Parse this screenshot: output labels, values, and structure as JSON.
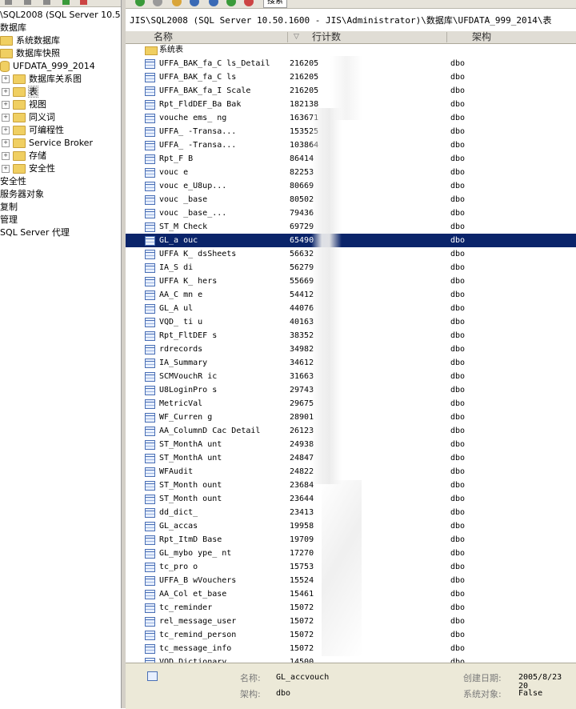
{
  "left_panel": {
    "tree": [
      {
        "label": "\\SQL2008 (SQL Server 10.50",
        "indent": 0,
        "icon": "none",
        "expander": ""
      },
      {
        "label": "数据库",
        "indent": 0,
        "icon": "none",
        "expander": ""
      },
      {
        "label": "系统数据库",
        "indent": 0,
        "icon": "folder",
        "expander": ""
      },
      {
        "label": "数据库快照",
        "indent": 0,
        "icon": "folder",
        "expander": ""
      },
      {
        "label": "UFDATA_999_2014",
        "indent": 0,
        "icon": "database",
        "expander": ""
      },
      {
        "label": "数据库关系图",
        "indent": 1,
        "icon": "folder",
        "expander": "+"
      },
      {
        "label": "表",
        "indent": 1,
        "icon": "folder",
        "expander": "+",
        "selected": true
      },
      {
        "label": "视图",
        "indent": 1,
        "icon": "folder",
        "expander": "+"
      },
      {
        "label": "同义词",
        "indent": 1,
        "icon": "folder",
        "expander": "+"
      },
      {
        "label": "可编程性",
        "indent": 1,
        "icon": "folder",
        "expander": "+"
      },
      {
        "label": "Service Broker",
        "indent": 1,
        "icon": "folder",
        "expander": "+"
      },
      {
        "label": "存储",
        "indent": 1,
        "icon": "folder",
        "expander": "+"
      },
      {
        "label": "安全性",
        "indent": 1,
        "icon": "folder",
        "expander": "+"
      },
      {
        "label": "安全性",
        "indent": 0,
        "icon": "none",
        "expander": ""
      },
      {
        "label": "服务器对象",
        "indent": 0,
        "icon": "none",
        "expander": ""
      },
      {
        "label": "复制",
        "indent": 0,
        "icon": "none",
        "expander": ""
      },
      {
        "label": "管理",
        "indent": 0,
        "icon": "none",
        "expander": ""
      },
      {
        "label": "SQL Server 代理",
        "indent": 0,
        "icon": "none",
        "expander": ""
      }
    ]
  },
  "right_panel": {
    "toolbar": {
      "search_tab": "搜索"
    },
    "path": "JIS\\SQL2008 (SQL Server 10.50.1600 - JIS\\Administrator)\\数据库\\UFDATA_999_2014\\表",
    "columns": {
      "name": "名称",
      "count": "行计数",
      "schema": "架构",
      "sort_indicator": "▽"
    },
    "rows": [
      {
        "name": "系统表",
        "count": "",
        "schema": "",
        "type": "folder"
      },
      {
        "name": "UFFA_BAK_fa_C    ls_Detail",
        "count": "216205",
        "schema": "dbo",
        "type": "table"
      },
      {
        "name": "UFFA_BAK_fa_C    ls",
        "count": "216205",
        "schema": "dbo",
        "type": "table"
      },
      {
        "name": "UFFA_BAK_fa_I    Scale",
        "count": "216205",
        "schema": "dbo",
        "type": "table"
      },
      {
        "name": "Rpt_FldDEF_Ba    Bak",
        "count": "182138",
        "schema": "dbo",
        "type": "table"
      },
      {
        "name": "vouche    ems_ ng",
        "count": "163671",
        "schema": "dbo",
        "type": "table"
      },
      {
        "name": "UFFA_     -Transa...",
        "count": "153525",
        "schema": "dbo",
        "type": "table"
      },
      {
        "name": "UFFA_     -Transa...",
        "count": "103864",
        "schema": "dbo",
        "type": "table"
      },
      {
        "name": "Rpt_F     B",
        "count": "86414",
        "schema": "dbo",
        "type": "table"
      },
      {
        "name": "vouc      e",
        "count": "82253",
        "schema": "dbo",
        "type": "table"
      },
      {
        "name": "vouc      e_U8up...",
        "count": "80669",
        "schema": "dbo",
        "type": "table"
      },
      {
        "name": "vouc      _base",
        "count": "80502",
        "schema": "dbo",
        "type": "table"
      },
      {
        "name": "vouc      _base_...",
        "count": "79436",
        "schema": "dbo",
        "type": "table"
      },
      {
        "name": "ST_M      Check",
        "count": "69729",
        "schema": "dbo",
        "type": "table"
      },
      {
        "name": "GL_a    ouc",
        "count": "65490",
        "schema": "dbo",
        "type": "table",
        "selected": true
      },
      {
        "name": "UFFA    K_   dsSheets",
        "count": "56632",
        "schema": "dbo",
        "type": "table"
      },
      {
        "name": "IA_S    di",
        "count": "56279",
        "schema": "dbo",
        "type": "table"
      },
      {
        "name": "UFFA    K_     hers",
        "count": "55669",
        "schema": "dbo",
        "type": "table"
      },
      {
        "name": "AA_C    mn    e",
        "count": "54412",
        "schema": "dbo",
        "type": "table"
      },
      {
        "name": "GL_A    ul",
        "count": "44076",
        "schema": "dbo",
        "type": "table"
      },
      {
        "name": "VQD_    ti   u",
        "count": "40163",
        "schema": "dbo",
        "type": "table"
      },
      {
        "name": "Rpt_FltDEF   s",
        "count": "38352",
        "schema": "dbo",
        "type": "table"
      },
      {
        "name": "rdrecords",
        "count": "34982",
        "schema": "dbo",
        "type": "table"
      },
      {
        "name": "IA_Summary",
        "count": "34612",
        "schema": "dbo",
        "type": "table"
      },
      {
        "name": "SCMVouchR    ic",
        "count": "31663",
        "schema": "dbo",
        "type": "table"
      },
      {
        "name": "U8LoginPro    s",
        "count": "29743",
        "schema": "dbo",
        "type": "table"
      },
      {
        "name": "MetricVal",
        "count": "29675",
        "schema": "dbo",
        "type": "table"
      },
      {
        "name": "WF_Curren    g",
        "count": "28901",
        "schema": "dbo",
        "type": "table"
      },
      {
        "name": "AA_ColumnD   Cac   Detail",
        "count": "26123",
        "schema": "dbo",
        "type": "table"
      },
      {
        "name": "ST_MonthA   unt",
        "count": "24938",
        "schema": "dbo",
        "type": "table"
      },
      {
        "name": "ST_MonthA   unt",
        "count": "24847",
        "schema": "dbo",
        "type": "table"
      },
      {
        "name": "WFAudit",
        "count": "24822",
        "schema": "dbo",
        "type": "table"
      },
      {
        "name": "ST_Month    ount",
        "count": "23684",
        "schema": "dbo",
        "type": "table"
      },
      {
        "name": "ST_Month    ount",
        "count": "23644",
        "schema": "dbo",
        "type": "table"
      },
      {
        "name": "dd_dict_",
        "count": "23413",
        "schema": "dbo",
        "type": "table"
      },
      {
        "name": "GL_accas",
        "count": "19958",
        "schema": "dbo",
        "type": "table"
      },
      {
        "name": "Rpt_ItmD    Base",
        "count": "19709",
        "schema": "dbo",
        "type": "table"
      },
      {
        "name": "GL_mybo   ype_   nt",
        "count": "17270",
        "schema": "dbo",
        "type": "table"
      },
      {
        "name": "tc_pro    o",
        "count": "15753",
        "schema": "dbo",
        "type": "table"
      },
      {
        "name": "UFFA_B     wVouchers",
        "count": "15524",
        "schema": "dbo",
        "type": "table"
      },
      {
        "name": "AA_Col     et_base",
        "count": "15461",
        "schema": "dbo",
        "type": "table"
      },
      {
        "name": "tc_reminder",
        "count": "15072",
        "schema": "dbo",
        "type": "table"
      },
      {
        "name": "rel_message_user",
        "count": "15072",
        "schema": "dbo",
        "type": "table"
      },
      {
        "name": "tc_remind_person",
        "count": "15072",
        "schema": "dbo",
        "type": "table"
      },
      {
        "name": "tc_message_info",
        "count": "15072",
        "schema": "dbo",
        "type": "table"
      },
      {
        "name": "VQD_Dictionary",
        "count": "14500",
        "schema": "dbo",
        "type": "table"
      }
    ],
    "properties": {
      "name_label": "名称:",
      "name_value": "GL_accvouch",
      "schema_label": "架构:",
      "schema_value": "dbo",
      "created_label": "创建日期:",
      "created_value": "2005/8/23 20",
      "system_label": "系统对象:",
      "system_value": "False"
    }
  },
  "colors": {
    "selection": "#0a246a",
    "chrome": "#e0ddd5",
    "folder": "#f0cf62"
  }
}
